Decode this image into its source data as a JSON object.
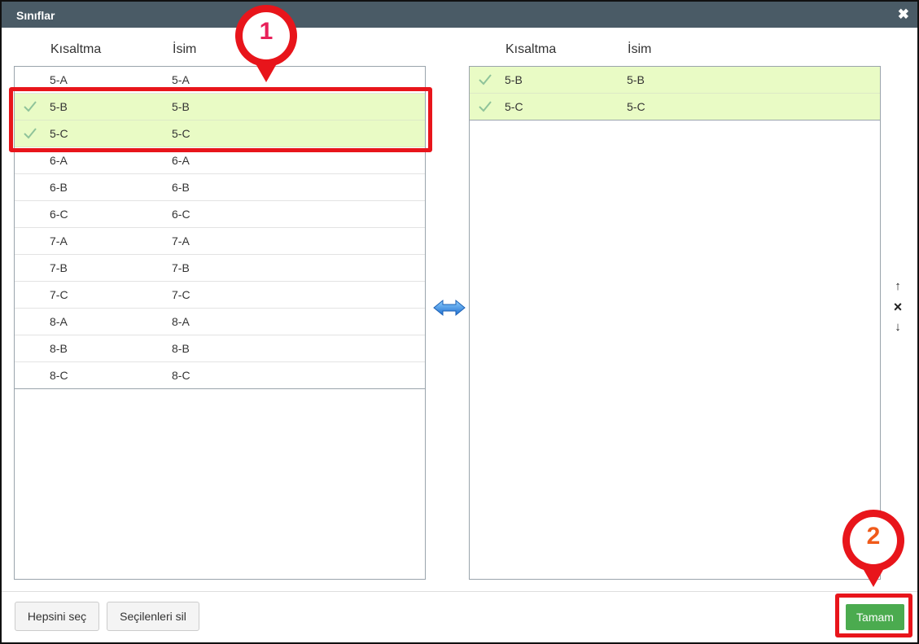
{
  "dialog": {
    "title": "Sınıflar"
  },
  "left": {
    "headers": {
      "abbr": "Kısaltma",
      "name": "İsim"
    },
    "rows": [
      {
        "abbr": "5-A",
        "name": "5-A",
        "selected": false
      },
      {
        "abbr": "5-B",
        "name": "5-B",
        "selected": true
      },
      {
        "abbr": "5-C",
        "name": "5-C",
        "selected": true
      },
      {
        "abbr": "6-A",
        "name": "6-A",
        "selected": false
      },
      {
        "abbr": "6-B",
        "name": "6-B",
        "selected": false
      },
      {
        "abbr": "6-C",
        "name": "6-C",
        "selected": false
      },
      {
        "abbr": "7-A",
        "name": "7-A",
        "selected": false
      },
      {
        "abbr": "7-B",
        "name": "7-B",
        "selected": false
      },
      {
        "abbr": "7-C",
        "name": "7-C",
        "selected": false
      },
      {
        "abbr": "8-A",
        "name": "8-A",
        "selected": false
      },
      {
        "abbr": "8-B",
        "name": "8-B",
        "selected": false
      },
      {
        "abbr": "8-C",
        "name": "8-C",
        "selected": false
      }
    ]
  },
  "right": {
    "headers": {
      "abbr": "Kısaltma",
      "name": "İsim"
    },
    "rows": [
      {
        "abbr": "5-B",
        "name": "5-B",
        "selected": true
      },
      {
        "abbr": "5-C",
        "name": "5-C",
        "selected": true
      }
    ]
  },
  "side_controls": {
    "up": "↑",
    "remove": "×",
    "down": "↓"
  },
  "footer": {
    "select_all": "Hepsini seç",
    "delete_selected": "Seçilenleri sil",
    "ok": "Tamam"
  },
  "annotations": {
    "step1": "1",
    "step2": "2",
    "step1_color": "#e8205a",
    "step2_color": "#f05a1a",
    "highlight_color": "#e8151b"
  },
  "colors": {
    "titlebar": "#4a5b66",
    "selected_row": "#e9fbc5",
    "ok_button": "#4bab4f",
    "swap_icon": "#3a8fe0"
  },
  "icons": {
    "close": "close-icon",
    "check": "check-icon",
    "swap": "swap-arrows-icon",
    "up": "arrow-up-icon",
    "remove": "remove-icon",
    "down": "arrow-down-icon"
  }
}
